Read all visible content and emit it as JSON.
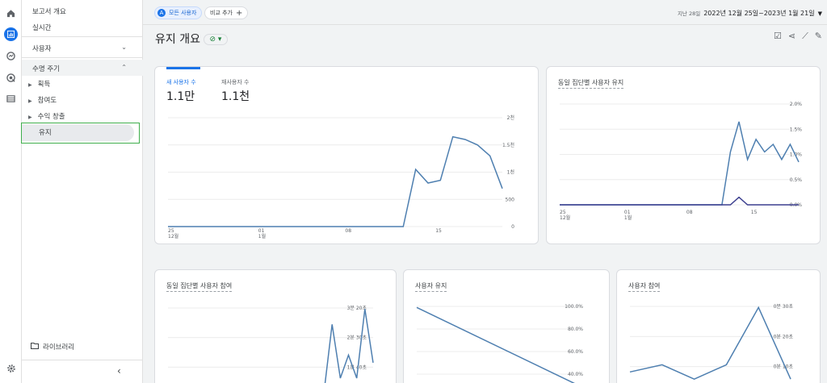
{
  "nav": {
    "items": [
      {
        "label": "보고서 개요"
      },
      {
        "label": "실시간"
      },
      {
        "label": "사용자"
      },
      {
        "label": "수명 주기"
      },
      {
        "label": "획득"
      },
      {
        "label": "참여도"
      },
      {
        "label": "수익 창출"
      },
      {
        "label": "유지"
      }
    ],
    "library": "라이브러리",
    "collapse_icon": "chevron-left-icon"
  },
  "topbar": {
    "segment_chip": "모든 사용자",
    "compare_chip": "비교 추가",
    "date_label": "지난 28일",
    "date_range": "2022년 12월 25일~2023년 1월 21일"
  },
  "page": {
    "title": "유지 개요"
  },
  "cards": {
    "main": {
      "metric1_label": "새 사용자 수",
      "metric1_value": "1.1만",
      "metric2_label": "재사용자 수",
      "metric2_value": "1.1천"
    },
    "cohort_retention": {
      "title": "동일 집단별 사용자 유지"
    },
    "cohort_engagement": {
      "title": "동일 집단별 사용자 참여"
    },
    "user_retention": {
      "title": "사용자 유지"
    },
    "user_engagement": {
      "title": "사용자 참여"
    }
  },
  "chart_data": [
    {
      "type": "line",
      "x_ticks": [
        "25\n12월",
        "01\n1월",
        "08",
        "15"
      ],
      "y_ticks": [
        "2천",
        "1.5천",
        "1천",
        "500",
        "0"
      ],
      "ylim": [
        0,
        2000
      ],
      "series": [
        {
          "values": [
            0,
            0,
            0,
            0,
            0,
            0,
            0,
            0,
            0,
            0,
            0,
            0,
            0,
            0,
            0,
            0,
            0,
            0,
            0,
            0,
            1050,
            800,
            850,
            1650,
            1600,
            1500,
            1300,
            700
          ]
        }
      ]
    },
    {
      "type": "line",
      "x_ticks": [
        "25\n12월",
        "01\n1월",
        "08",
        "15"
      ],
      "y_ticks": [
        "2.0%",
        "1.5%",
        "1.0%",
        "0.5%",
        "0.0%"
      ],
      "ylim": [
        0,
        2
      ],
      "series": [
        {
          "values": [
            0,
            0,
            0,
            0,
            0,
            0,
            0,
            0,
            0,
            0,
            0,
            0,
            0,
            0,
            0,
            0,
            0,
            0,
            0,
            0,
            1.05,
            1.65,
            0.9,
            1.3,
            1.05,
            1.2,
            0.9,
            1.2,
            0.85
          ]
        },
        {
          "values": [
            0,
            0,
            0,
            0,
            0,
            0,
            0,
            0,
            0,
            0,
            0,
            0,
            0,
            0,
            0,
            0,
            0,
            0,
            0,
            0,
            0,
            0.15,
            0,
            0,
            0,
            0,
            0,
            0,
            0
          ]
        }
      ]
    },
    {
      "type": "line",
      "y_ticks": [
        "3분 20초",
        "2분 30초",
        "1분 40초"
      ],
      "series": [
        {
          "values": [
            0,
            0,
            0,
            0,
            0,
            0,
            0,
            0,
            0,
            0,
            0,
            0,
            0,
            0,
            0,
            0,
            0,
            0,
            0,
            0,
            0.9,
            0.2,
            0.5,
            0.2,
            1.1,
            0.4
          ]
        }
      ]
    },
    {
      "type": "line",
      "y_ticks": [
        "100.0%",
        "80.0%",
        "60.0%",
        "40.0%"
      ],
      "series": [
        {
          "values": [
            100,
            10
          ]
        }
      ]
    },
    {
      "type": "line",
      "y_ticks": [
        "0분 30초",
        "0분 20초",
        "0분 10초"
      ],
      "series": [
        {
          "values": [
            0.15,
            0.2,
            0.1,
            0.2,
            0.6,
            0.1
          ]
        }
      ]
    }
  ]
}
